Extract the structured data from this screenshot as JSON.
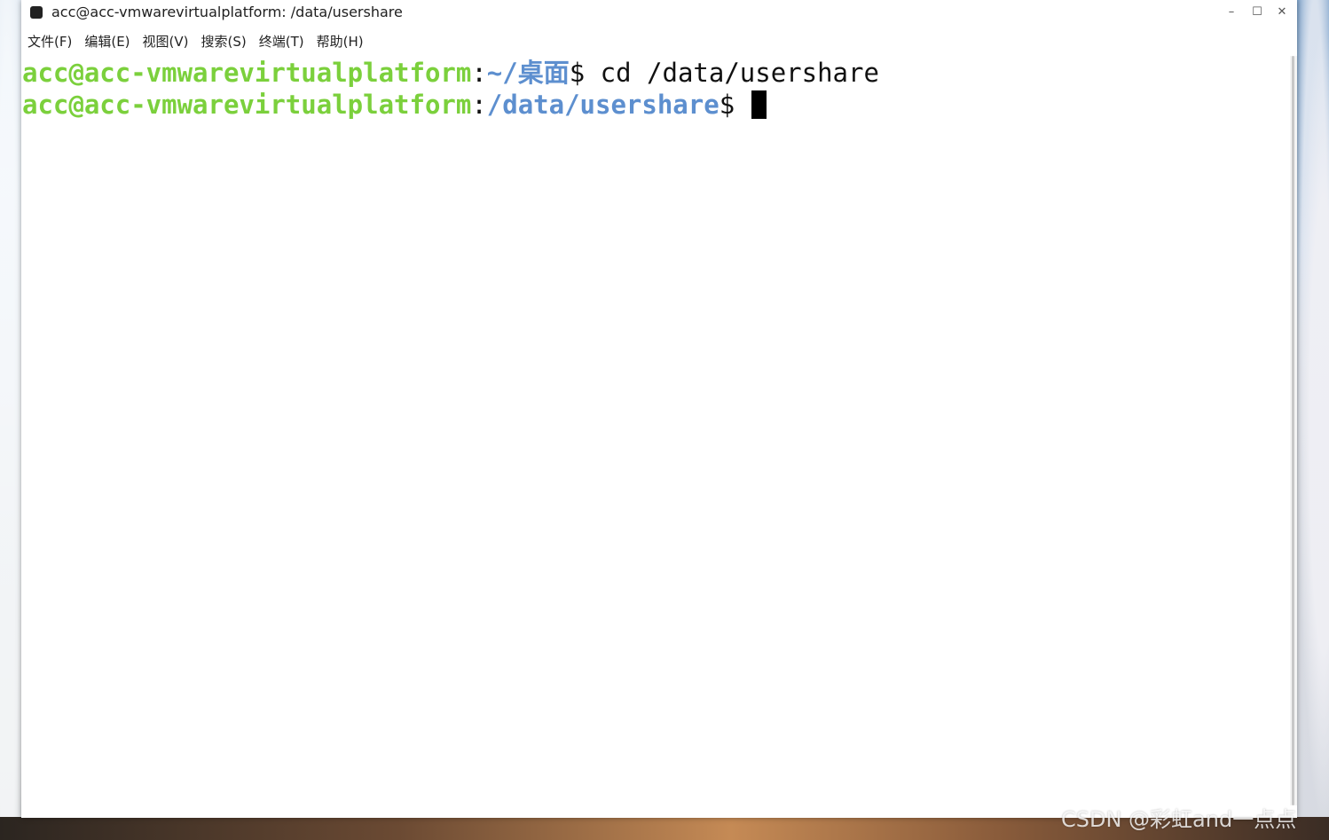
{
  "window": {
    "title": "acc@acc-vmwarevirtualplatform: /data/usershare",
    "controls": {
      "minimize": "–",
      "maximize": "☐",
      "close": "✕"
    }
  },
  "menu": {
    "items": [
      {
        "label": "文件(F)"
      },
      {
        "label": "编辑(E)"
      },
      {
        "label": "视图(V)"
      },
      {
        "label": "搜索(S)"
      },
      {
        "label": "终端(T)"
      },
      {
        "label": "帮助(H)"
      }
    ]
  },
  "terminal": {
    "lines": [
      {
        "user_host": "acc@acc-vmwarevirtualplatform",
        "colon": ":",
        "path": "~/桌面",
        "prompt": "$ ",
        "command": "cd /data/usershare"
      },
      {
        "user_host": "acc@acc-vmwarevirtualplatform",
        "colon": ":",
        "path": "/data/usershare",
        "prompt": "$ ",
        "command": ""
      }
    ],
    "colors": {
      "user_host": "#7bd03c",
      "path": "#5d8fcf",
      "text": "#111111",
      "background": "#ffffff"
    }
  },
  "watermark": "CSDN @彩虹and一点点"
}
